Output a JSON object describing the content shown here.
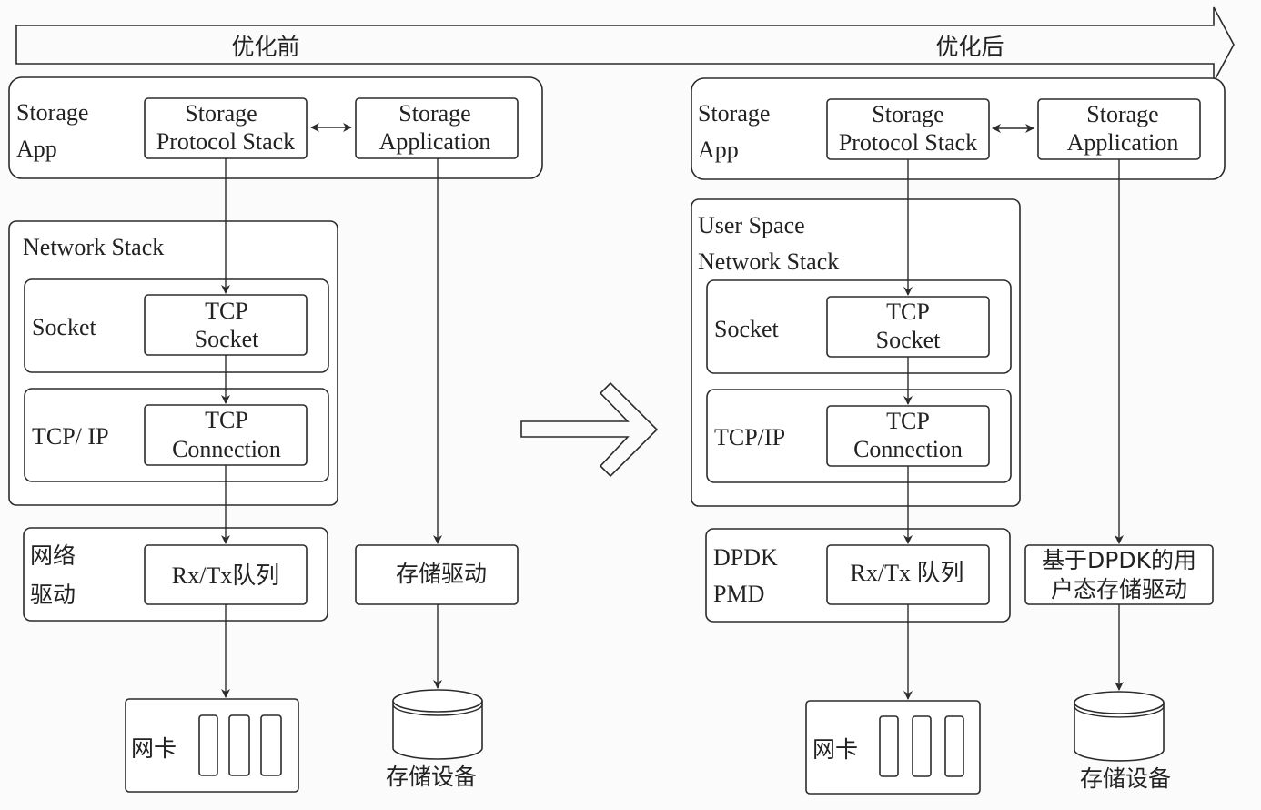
{
  "banner": {
    "before_label": "优化前",
    "after_label": "优化后"
  },
  "before": {
    "storage_app": {
      "label_line1": "Storage",
      "label_line2": "App",
      "protocol_stack_line1": "Storage",
      "protocol_stack_line2": "Protocol Stack",
      "application_line1": "Storage",
      "application_line2": "Application"
    },
    "network_stack": {
      "title": "Network Stack",
      "socket_layer": "Socket",
      "tcp_socket_line1": "TCP",
      "tcp_socket_line2": "Socket",
      "tcpip_layer": "TCP/ IP",
      "tcp_conn_line1": "TCP",
      "tcp_conn_line2": "Connection"
    },
    "driver": {
      "label_line1": "网络",
      "label_line2": "驱动",
      "queue": "Rx/Tx队列"
    },
    "storage_driver": "存储驱动",
    "nic": "网卡",
    "storage_device": "存储设备"
  },
  "after": {
    "storage_app": {
      "label_line1": "Storage",
      "label_line2": "App",
      "protocol_stack_line1": "Storage",
      "protocol_stack_line2": "Protocol Stack",
      "application_line1": "Storage",
      "application_line2": "Application"
    },
    "network_stack": {
      "title_line1": "User Space",
      "title_line2": "Network Stack",
      "socket_layer": "Socket",
      "tcp_socket_line1": "TCP",
      "tcp_socket_line2": "Socket",
      "tcpip_layer": "TCP/IP",
      "tcp_conn_line1": "TCP",
      "tcp_conn_line2": "Connection"
    },
    "driver": {
      "label_line1": "DPDK",
      "label_line2": "PMD",
      "queue": "Rx/Tx 队列"
    },
    "storage_driver_line1": "基于DPDK的用",
    "storage_driver_line2": "户态存储驱动",
    "nic": "网卡",
    "storage_device": "存储设备"
  }
}
